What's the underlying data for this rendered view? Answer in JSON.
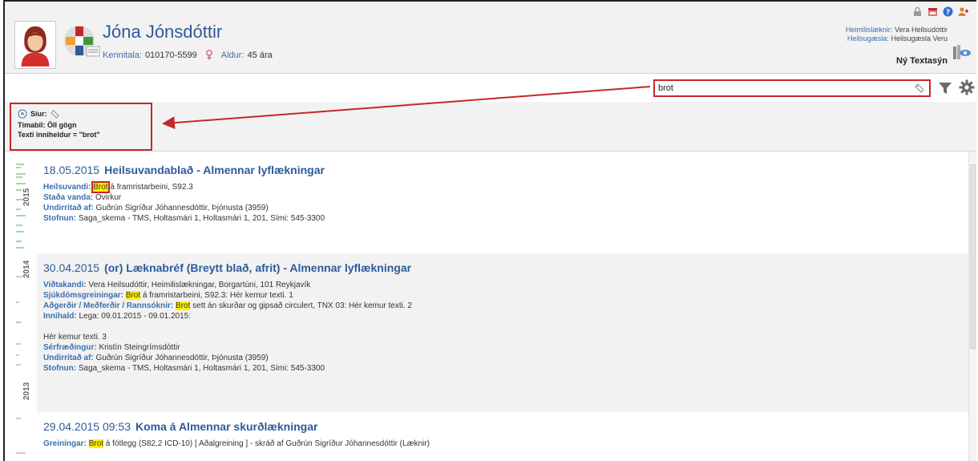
{
  "header": {
    "patient_name": "Jóna Jónsdóttir",
    "kennitala_label": "Kennitala:",
    "kennitala": "010170-5599",
    "age_label": "Aldur:",
    "age": "45 ára",
    "doctor_label": "Heimilislæknir:",
    "doctor": "Vera Heilsudóttir",
    "clinic_label": "Heilsugæsla:",
    "clinic": "Heilsugæsla Veru",
    "view_name": "Ný Textasýn"
  },
  "search": {
    "value": "brot"
  },
  "filter": {
    "title": "Síur:",
    "period": "Tímabil: Öll gögn",
    "text": "Texti inniheldur = \"brot\""
  },
  "timeline": {
    "years": [
      "2015",
      "2014",
      "2013"
    ]
  },
  "entries": [
    {
      "date": "18.05.2015",
      "title": "Heilsuvandablað - Almennar lyflækningar",
      "f1_key": "Heilsuvandi:",
      "f1_hl": "Brot",
      "f1_rest": " á framristarbeini, S92.3",
      "f2_key": "Staða vanda:",
      "f2_val": " Óvirkur",
      "f3_key": "Undirritað af:",
      "f3_val": " Guðrún Sigríður Jóhannesdóttir, Þjónusta (3959)",
      "f4_key": "Stofnun:",
      "f4_val": " Saga_skema - TMS, Holtasmári 1, Holtasmári 1, 201, Sími: 545-3300"
    },
    {
      "date": "30.04.2015",
      "title": "(or) Læknabréf (Breytt blað, afrit) - Almennar lyflækningar",
      "f1_key": "Viðtakandi:",
      "f1_val": " Vera Heilsudóttir, Heimilislækningar, Borgartúni, 101 Reykjavík",
      "f2_key": "Sjúkdómsgreiningar:",
      "f2_hl": "Brot",
      "f2_rest": " á framristarbeini, S92.3: Hér kemur texti. 1",
      "f3_key": "Aðgerðir / Meðferðir / Rannsóknir:",
      "f3_hl": "Brot",
      "f3_rest": " sett án skurðar og gipsað circulert, TNX 03: Hér kemur texti. 2",
      "f4_key": "Innihald:",
      "f4_val": " Lega: 09.01.2015 - 09.01.2015:",
      "body": "Hér kemur texti. 3",
      "f5_key": "Sérfræðingur:",
      "f5_val": " Kristín Steingrímsdóttir",
      "f6_key": "Undirritað af:",
      "f6_val": " Guðrún Sigríður Jóhannesdóttir, Þjónusta (3959)",
      "f7_key": "Stofnun:",
      "f7_val": " Saga_skema - TMS, Holtasmári 1, Holtasmári 1, 201, Sími: 545-3300"
    },
    {
      "date": "29.04.2015 09:53",
      "title": "Koma á Almennar skurðlækningar",
      "f1_key": "Greiningar:",
      "f1_hl": "Brot",
      "f1_rest": " á fótlegg (S82.2 ICD-10) [ Aðalgreining ] - skráð af Guðrún Sigríður Jóhannesdóttir (Læknir)"
    }
  ],
  "colors": {
    "accent": "#2e5a9c",
    "highlight": "#ffef00",
    "annotation": "#c62828"
  }
}
